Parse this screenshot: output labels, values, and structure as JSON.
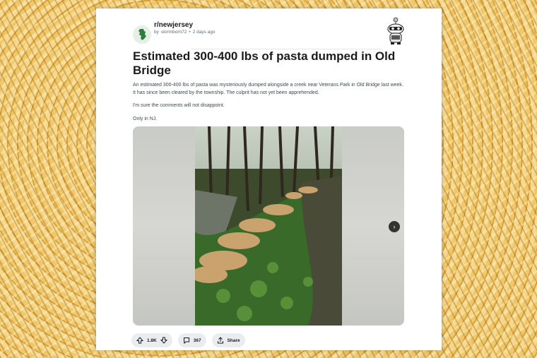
{
  "post": {
    "subreddit": "r/newjersey",
    "meta_by": "by",
    "author": "stormborn72",
    "separator": "•",
    "age": "2 days ago",
    "title": "Estimated 300-400 lbs of pasta dumped in Old Bridge",
    "paragraphs": [
      "An estimated 300-400 lbs of pasta was mysteriously dumped alongside a creek near Veterans Park in Old Bridge last week. It has since been cleared by the township. The culprit has not yet been apprehended.",
      "I'm sure the comments will not disappoint.",
      "Only in NJ."
    ],
    "votes": "1.8K",
    "comments": "367",
    "share_label": "Share"
  },
  "icons": {
    "subreddit": "new-jersey-state-icon",
    "upvote": "arrow-up-icon",
    "downvote": "arrow-down-icon",
    "comments": "comment-bubble-icon",
    "share": "share-icon",
    "next": "chevron-right-icon",
    "mascot": "snoo-mascot-icon"
  },
  "colors": {
    "card": "#ffffff",
    "pill": "#eaedef",
    "text": "#1c1c1c",
    "meta": "#576f76"
  }
}
